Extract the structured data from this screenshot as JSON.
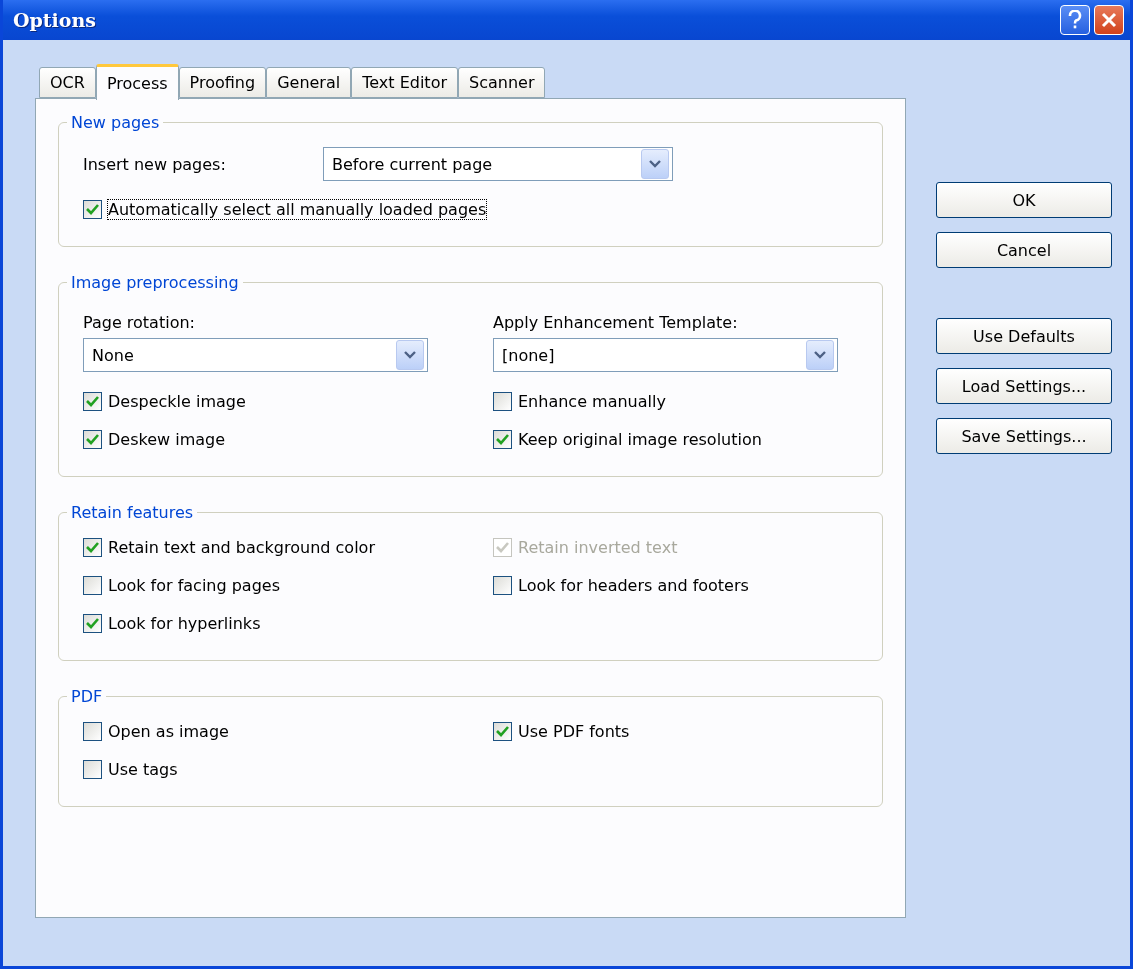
{
  "window": {
    "title": "Options"
  },
  "tabs": [
    {
      "label": "OCR",
      "selected": false
    },
    {
      "label": "Process",
      "selected": true
    },
    {
      "label": "Proofing",
      "selected": false
    },
    {
      "label": "General",
      "selected": false
    },
    {
      "label": "Text Editor",
      "selected": false
    },
    {
      "label": "Scanner",
      "selected": false
    }
  ],
  "sections": [
    {
      "title": "New pages",
      "kind": "single",
      "controls": [
        {
          "kind": "inline-select",
          "label": "Insert new pages:",
          "value": "Before current page"
        },
        {
          "kind": "checkbox",
          "label": "Automatically select all manually loaded pages",
          "checked": true,
          "disabled": false,
          "focused": true
        }
      ]
    },
    {
      "title": "Image preprocessing",
      "kind": "two-column",
      "columns": [
        [
          {
            "kind": "stacked-select",
            "label": "Page rotation:",
            "value": "None"
          },
          {
            "kind": "checkbox",
            "label": "Despeckle image",
            "checked": true,
            "disabled": false
          },
          {
            "kind": "checkbox",
            "label": "Deskew image",
            "checked": true,
            "disabled": false
          }
        ],
        [
          {
            "kind": "stacked-select",
            "label": "Apply Enhancement Template:",
            "value": "[none]"
          },
          {
            "kind": "checkbox",
            "label": "Enhance manually",
            "checked": false,
            "disabled": false
          },
          {
            "kind": "checkbox",
            "label": "Keep original image resolution",
            "checked": true,
            "disabled": false
          }
        ]
      ]
    },
    {
      "title": "Retain features",
      "kind": "two-column",
      "columns": [
        [
          {
            "kind": "checkbox",
            "label": "Retain text and background color",
            "checked": true,
            "disabled": false
          },
          {
            "kind": "checkbox",
            "label": "Look for facing pages",
            "checked": false,
            "disabled": false
          },
          {
            "kind": "checkbox",
            "label": "Look for hyperlinks",
            "checked": true,
            "disabled": false
          }
        ],
        [
          {
            "kind": "checkbox",
            "label": "Retain inverted text",
            "checked": true,
            "disabled": true
          },
          {
            "kind": "checkbox",
            "label": "Look for headers and footers",
            "checked": false,
            "disabled": false
          }
        ]
      ]
    },
    {
      "title": "PDF",
      "kind": "two-column",
      "columns": [
        [
          {
            "kind": "checkbox",
            "label": "Open as image",
            "checked": false,
            "disabled": false
          },
          {
            "kind": "checkbox",
            "label": "Use tags",
            "checked": false,
            "disabled": false
          }
        ],
        [
          {
            "kind": "checkbox",
            "label": "Use PDF fonts",
            "checked": true,
            "disabled": false
          }
        ]
      ]
    }
  ],
  "button_groups": [
    [
      "OK",
      "Cancel"
    ],
    [
      "Use Defaults",
      "Load Settings...",
      "Save Settings..."
    ]
  ]
}
